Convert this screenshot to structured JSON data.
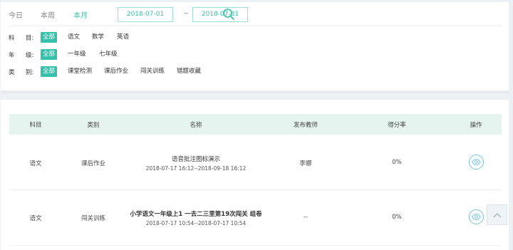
{
  "range_tabs": [
    {
      "label": "今日",
      "active": false
    },
    {
      "label": "本周",
      "active": false
    },
    {
      "label": "本月",
      "active": true
    }
  ],
  "date_range": {
    "start": "2018-07-01",
    "separator": "--",
    "end": "2018-07-31"
  },
  "icons": {
    "search": "search-icon",
    "view": "eye-icon",
    "back_to_top": "chevron-up-icon"
  },
  "filters": {
    "subject": {
      "label_a": "科",
      "label_b": "目:",
      "options": [
        "全部",
        "语文",
        "数学",
        "英语"
      ],
      "selected": "全部"
    },
    "grade": {
      "label_a": "年",
      "label_b": "级:",
      "options": [
        "全部",
        "一年级",
        "七年级"
      ],
      "selected": "全部"
    },
    "category": {
      "label_a": "类",
      "label_b": "别:",
      "options": [
        "全部",
        "课堂检测",
        "课后作业",
        "闯关训练",
        "错题收藏"
      ],
      "selected": "全部"
    }
  },
  "table": {
    "columns": [
      "科目",
      "类别",
      "名称",
      "发布教师",
      "得分率",
      "操作"
    ],
    "rows": [
      {
        "subject": "语文",
        "category": "课后作业",
        "name": "语音批注图标演示",
        "time": "2018-07-17 16:12--2018-09-18 16:12",
        "teacher": "李娜",
        "score_rate": "0%"
      },
      {
        "subject": "语文",
        "category": "闯关训练",
        "name": "小学语文一年级上1   一去二三里第19次闯关 组卷",
        "time": "2018-07-17 10:54--2018-07-17 10:54",
        "teacher": "--",
        "score_rate": "0%"
      }
    ]
  },
  "colors": {
    "accent": "#35c0a9",
    "header_bg": "#e5f4ef",
    "page_bg": "#eef1f4",
    "view_border": "#6fc3df"
  }
}
